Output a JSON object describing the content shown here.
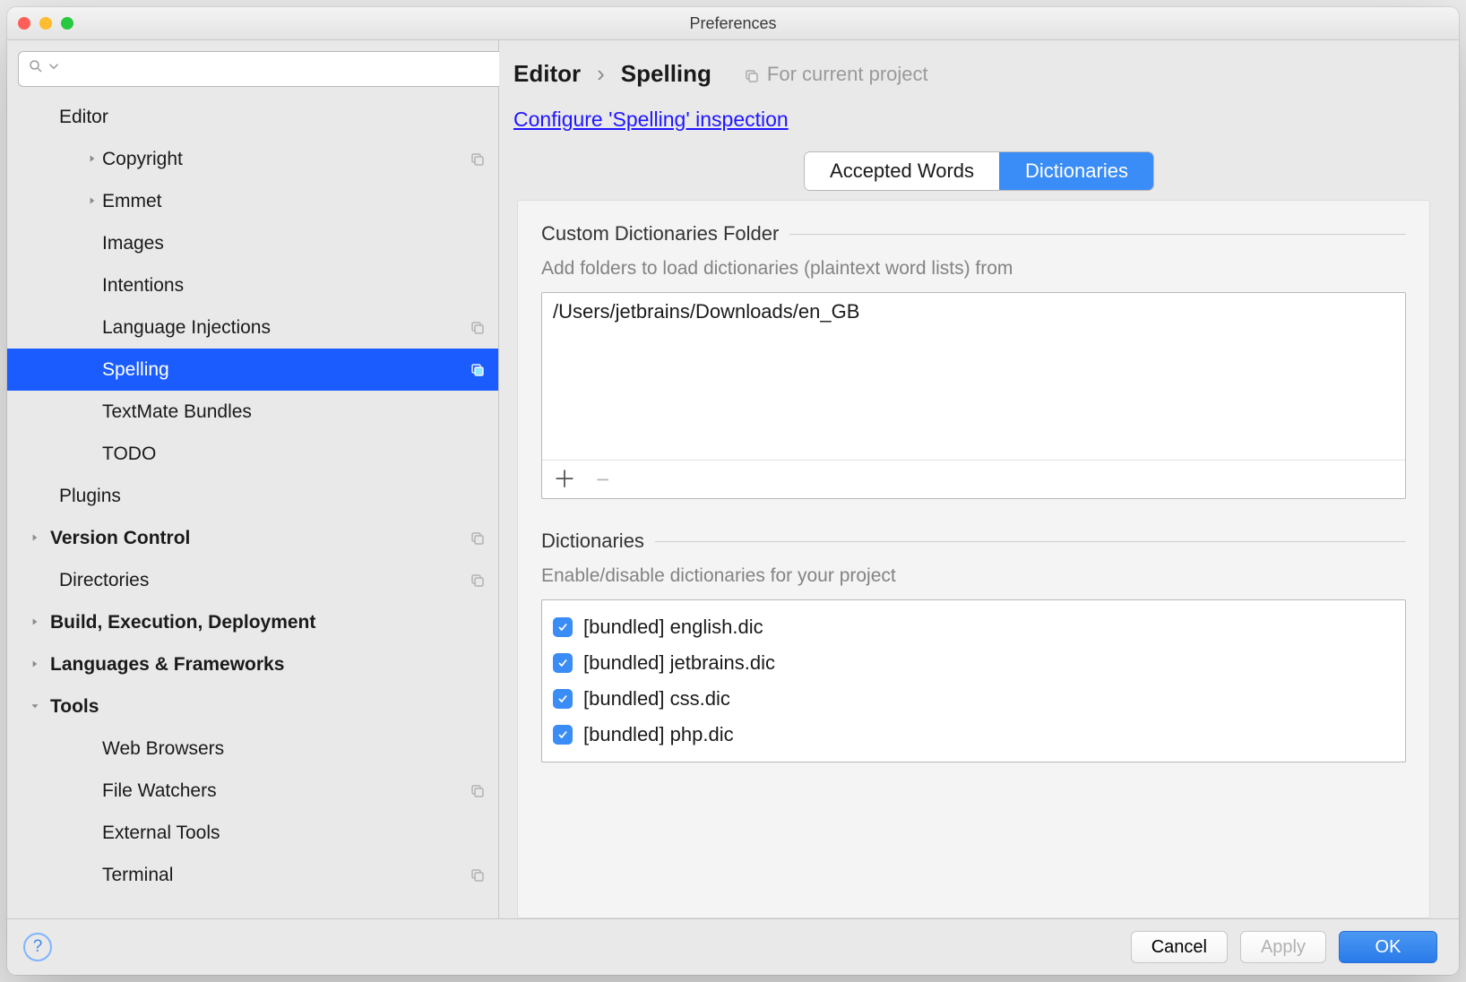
{
  "window": {
    "title": "Preferences"
  },
  "breadcrumb": {
    "editor": "Editor",
    "spelling": "Spelling",
    "for_project": "For current project"
  },
  "link": {
    "configure": "Configure 'Spelling' inspection"
  },
  "tabs": {
    "accepted": "Accepted Words",
    "dictionaries": "Dictionaries"
  },
  "section_custom": {
    "title": "Custom Dictionaries Folder",
    "sub": "Add folders to load dictionaries (plaintext word lists) from",
    "rows": [
      "/Users/jetbrains/Downloads/en_GB"
    ]
  },
  "section_dicts": {
    "title": "Dictionaries",
    "sub": "Enable/disable dictionaries for your project",
    "items": [
      {
        "checked": true,
        "label": "[bundled] english.dic"
      },
      {
        "checked": true,
        "label": "[bundled] jetbrains.dic"
      },
      {
        "checked": true,
        "label": "[bundled] css.dic"
      },
      {
        "checked": true,
        "label": "[bundled] php.dic"
      }
    ]
  },
  "footer": {
    "cancel": "Cancel",
    "apply": "Apply",
    "ok": "OK"
  },
  "tree": {
    "editor": "Editor",
    "copyright": "Copyright",
    "emmet": "Emmet",
    "images": "Images",
    "intentions": "Intentions",
    "lang_inj": "Language Injections",
    "spelling": "Spelling",
    "textmate": "TextMate Bundles",
    "todo": "TODO",
    "plugins": "Plugins",
    "vc": "Version Control",
    "directories": "Directories",
    "bed": "Build, Execution, Deployment",
    "lf": "Languages & Frameworks",
    "tools": "Tools",
    "web": "Web Browsers",
    "fw": "File Watchers",
    "ext": "External Tools",
    "terminal": "Terminal"
  }
}
